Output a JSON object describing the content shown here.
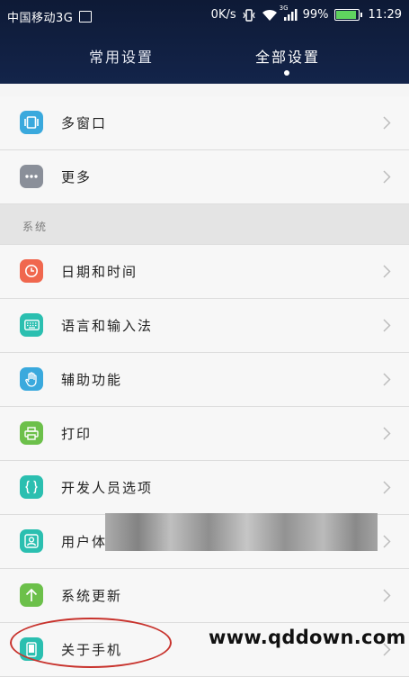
{
  "status_bar": {
    "carrier": "中国移动3G",
    "speed": "0K/s",
    "network_type": "3G",
    "battery_percent": "99%",
    "battery_level": 0.99,
    "time": "11:29"
  },
  "tabs": [
    {
      "label": "常用设置",
      "active": false
    },
    {
      "label": "全部设置",
      "active": true
    }
  ],
  "items_top": [
    {
      "label": "多窗口",
      "icon": "multi-window-icon",
      "color": "#3aa9dd"
    },
    {
      "label": "更多",
      "icon": "more-dots-icon",
      "color": "#8a8f99"
    }
  ],
  "section_system": "系统",
  "items_system": [
    {
      "label": "日期和时间",
      "icon": "clock-icon",
      "color": "#f0674e"
    },
    {
      "label": "语言和输入法",
      "icon": "keyboard-icon",
      "color": "#2bbfb0"
    },
    {
      "label": "辅助功能",
      "icon": "hand-icon",
      "color": "#3aa9dd"
    },
    {
      "label": "打印",
      "icon": "printer-icon",
      "color": "#6cc04a"
    },
    {
      "label": "开发人员选项",
      "icon": "braces-icon",
      "color": "#2bbfb0"
    },
    {
      "label": "用户体",
      "icon": "user-icon",
      "color": "#2bbfb0"
    },
    {
      "label": "系统更新",
      "icon": "update-arrow-icon",
      "color": "#6cc04a"
    },
    {
      "label": "关于手机",
      "icon": "phone-icon",
      "color": "#2bbfb0"
    }
  ],
  "watermark": "www.qddown.com"
}
